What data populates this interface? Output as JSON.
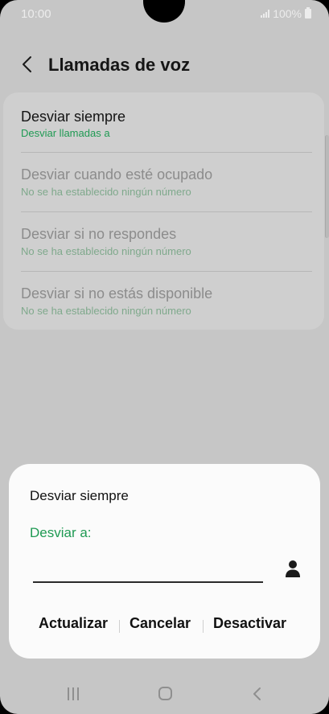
{
  "status_bar": {
    "time": "10:00",
    "battery": "100%",
    "icons": [
      "signal-icon",
      "battery-icon"
    ]
  },
  "header": {
    "back_icon": "chevron-left-icon",
    "title": "Llamadas de voz"
  },
  "forward_options": [
    {
      "title": "Desviar siempre",
      "subtitle": "Desviar llamadas a",
      "enabled": true
    },
    {
      "title": "Desviar cuando esté ocupado",
      "subtitle": "No se ha establecido ningún número",
      "enabled": false
    },
    {
      "title": "Desviar si no respondes",
      "subtitle": "No se ha establecido ningún número",
      "enabled": false
    },
    {
      "title": "Desviar si no estás disponible",
      "subtitle": "No se ha establecido ningún número",
      "enabled": false
    }
  ],
  "dialog": {
    "title": "Desviar siempre",
    "label": "Desviar a:",
    "input_value": "",
    "contact_icon": "person-icon",
    "buttons": {
      "update": "Actualizar",
      "cancel": "Cancelar",
      "deactivate": "Desactivar"
    }
  },
  "nav_bar": {
    "icons": [
      "recents-icon",
      "home-icon",
      "back-icon"
    ]
  },
  "colors": {
    "accent_green": "#1f9a53",
    "dim_green": "#7fa98c",
    "background_dimmed": "#c6c6c6",
    "dialog_bg": "#fbfbfb"
  }
}
